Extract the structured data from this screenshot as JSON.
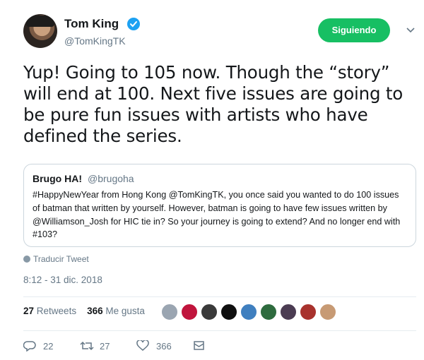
{
  "author": {
    "display_name": "Tom King",
    "handle": "@TomKingTK",
    "verified": true
  },
  "follow_button": {
    "label": "Siguiendo",
    "color": "#17bf63"
  },
  "tweet": {
    "text": "Yup! Going to 105 now. Though the “story” will end at 100. Next five issues are going to be pure fun issues with artists who have defined the series."
  },
  "quoted_tweet": {
    "display_name": "Brugo HA!",
    "handle": "@brugoha",
    "text": "#HappyNewYear from Hong Kong @TomKingTK, you once said you wanted to do 100 issues of batman that written by yourself. However, batman is going to have few issues written by @Williamson_Josh for HIC tie in? So your journey is going to extend? And no longer end with #103?"
  },
  "translate_label": "Traducir Tweet",
  "timestamp": "8:12 - 31 dic. 2018",
  "stats": {
    "retweets_count": "27",
    "retweets_label": "Retweets",
    "likes_count": "366",
    "likes_label": "Me gusta"
  },
  "actions": {
    "reply_count": "22",
    "retweet_count": "27",
    "like_count": "366"
  },
  "colors": {
    "accent": "#1da1f2",
    "muted": "#657786",
    "border": "#ccd6dd"
  }
}
